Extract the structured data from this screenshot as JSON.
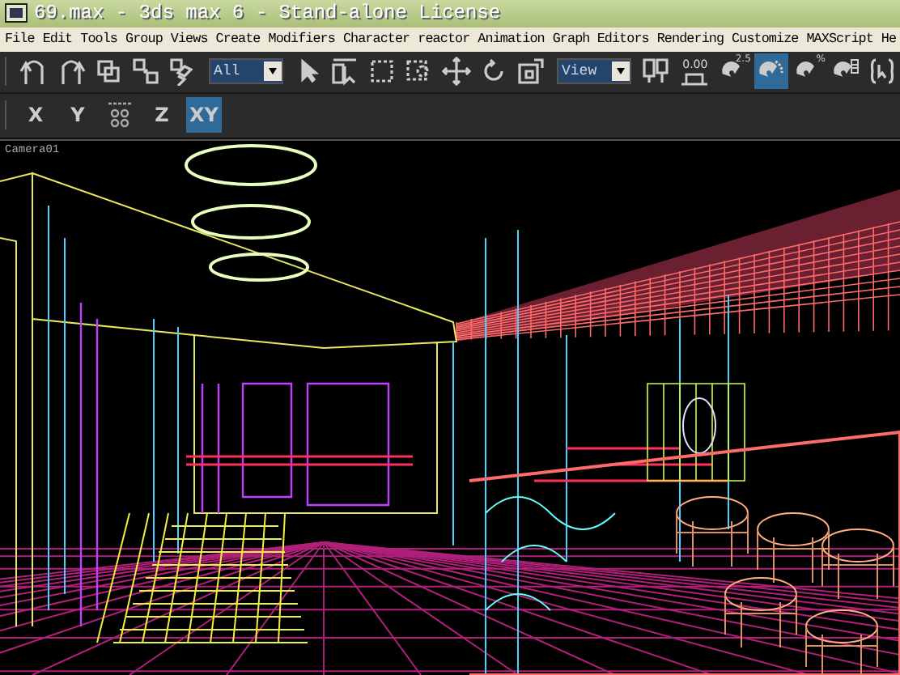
{
  "window": {
    "title": "69.max - 3ds max 6 - Stand-alone License"
  },
  "menu": [
    "File",
    "Edit",
    "Tools",
    "Group",
    "Views",
    "Create",
    "Modifiers",
    "Character",
    "reactor",
    "Animation",
    "Graph Editors",
    "Rendering",
    "Customize",
    "MAXScript",
    "He"
  ],
  "toolbar": [
    {
      "kind": "undo",
      "selected": false
    },
    {
      "kind": "redo",
      "selected": false
    },
    {
      "kind": "link",
      "selected": false
    },
    {
      "kind": "unlink",
      "selected": false
    },
    {
      "kind": "bind",
      "selected": false
    },
    {
      "kind": "dropdown",
      "value": "All"
    },
    {
      "kind": "select",
      "selected": false
    },
    {
      "kind": "selectname",
      "selected": false
    },
    {
      "kind": "region",
      "selected": false
    },
    {
      "kind": "window",
      "selected": false
    },
    {
      "kind": "move",
      "selected": false
    },
    {
      "kind": "rotate",
      "selected": false
    },
    {
      "kind": "scale",
      "selected": false
    },
    {
      "kind": "dropdown",
      "value": "View"
    },
    {
      "kind": "pivot",
      "selected": false
    },
    {
      "kind": "spinner",
      "label": "0.00",
      "selected": false
    },
    {
      "kind": "snap",
      "label": "2.5",
      "selected": false
    },
    {
      "kind": "anglesnap",
      "selected": true
    },
    {
      "kind": "percentsnap",
      "label": "%",
      "selected": false
    },
    {
      "kind": "spinnersnap",
      "selected": false
    },
    {
      "kind": "named",
      "selected": false
    }
  ],
  "axes": [
    {
      "kind": "text",
      "label": "X",
      "selected": false
    },
    {
      "kind": "text",
      "label": "Y",
      "selected": false
    },
    {
      "kind": "constraint",
      "selected": false
    },
    {
      "kind": "text",
      "label": "Z",
      "selected": false
    },
    {
      "kind": "text",
      "label": "XY",
      "selected": true
    }
  ],
  "viewport": {
    "label": "Camera01"
  }
}
